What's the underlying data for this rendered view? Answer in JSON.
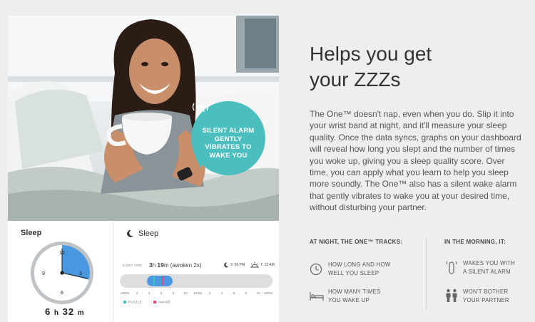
{
  "photo": {
    "alarm_bubble": {
      "icon": "vibrating-band-icon",
      "lines": [
        "SILENT ALARM",
        "GENTLY",
        "VIBRATES TO",
        "WAKE YOU"
      ]
    }
  },
  "clock_panel": {
    "title": "Sleep",
    "numbers": {
      "twelve": "12",
      "three": "3",
      "six": "6",
      "nine": "9"
    },
    "total_hours": "6",
    "total_h_unit": "h",
    "total_minutes": "32",
    "total_m_unit": "m",
    "sleep_fraction_of_dial": 0.29,
    "colors": {
      "sleep_arc": "#4a98e0",
      "dial": "#bfc3c6"
    }
  },
  "sleep_panel": {
    "title": "Sleep",
    "sleep_time_label": "SLEEP TIME",
    "hours": "3",
    "hours_unit": "h",
    "minutes": "19",
    "minutes_unit": "m",
    "awoken": "(awoken 2x)",
    "start_time": "3: 56 PM",
    "end_time": "7: 15 AM",
    "ticks": [
      "10PM",
      "2",
      "4",
      "6",
      "8",
      "10",
      "10AM",
      "2",
      "4",
      "6",
      "8",
      "10",
      "10PM"
    ],
    "legend": {
      "restless": "RUSTLE",
      "awake": "AWAKE"
    },
    "colors": {
      "restless": "#3dc6c6",
      "awake": "#e8457a",
      "sleep": "#4a98e0"
    }
  },
  "copy": {
    "heading_line1": "Helps you get",
    "heading_line2": "your ZZZs",
    "body": "The One™ doesn't nap, even when you do. Slip it into your wrist band at night, and it'll measure your sleep quality. Once the data syncs, graphs on your dashboard will reveal how long you slept and the number of times you woke up, giving you a sleep quality score. Over time, you can apply what you learn to help you sleep more soundly. The One™ also has a silent wake alarm that gently vibrates to wake you at your desired time, without disturbing your partner."
  },
  "features": {
    "night_heading": "AT NIGHT, THE ONE™ TRACKS:",
    "morning_heading": "IN THE MORNING, IT:",
    "night": [
      {
        "icon": "clock-icon",
        "line1": "HOW LONG AND HOW",
        "line2": "WELL YOU SLEEP"
      },
      {
        "icon": "bed-icon",
        "line1": "HOW MANY TIMES",
        "line2": "YOU WAKE UP"
      }
    ],
    "morning": [
      {
        "icon": "vibrating-device-icon",
        "line1": "WAKES YOU WITH",
        "line2": "A SILENT ALARM"
      },
      {
        "icon": "two-people-icon",
        "line1": "WON'T BOTHER",
        "line2": "YOUR PARTNER"
      }
    ]
  }
}
